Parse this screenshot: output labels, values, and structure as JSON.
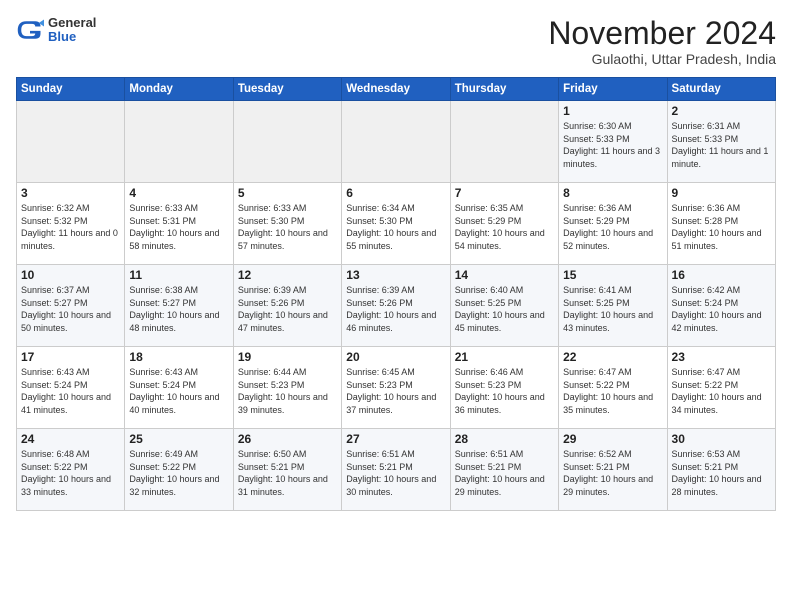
{
  "header": {
    "logo_general": "General",
    "logo_blue": "Blue",
    "month_title": "November 2024",
    "subtitle": "Gulaothi, Uttar Pradesh, India"
  },
  "days_of_week": [
    "Sunday",
    "Monday",
    "Tuesday",
    "Wednesday",
    "Thursday",
    "Friday",
    "Saturday"
  ],
  "weeks": [
    [
      {
        "day": "",
        "info": ""
      },
      {
        "day": "",
        "info": ""
      },
      {
        "day": "",
        "info": ""
      },
      {
        "day": "",
        "info": ""
      },
      {
        "day": "",
        "info": ""
      },
      {
        "day": "1",
        "info": "Sunrise: 6:30 AM\nSunset: 5:33 PM\nDaylight: 11 hours and 3 minutes."
      },
      {
        "day": "2",
        "info": "Sunrise: 6:31 AM\nSunset: 5:33 PM\nDaylight: 11 hours and 1 minute."
      }
    ],
    [
      {
        "day": "3",
        "info": "Sunrise: 6:32 AM\nSunset: 5:32 PM\nDaylight: 11 hours and 0 minutes."
      },
      {
        "day": "4",
        "info": "Sunrise: 6:33 AM\nSunset: 5:31 PM\nDaylight: 10 hours and 58 minutes."
      },
      {
        "day": "5",
        "info": "Sunrise: 6:33 AM\nSunset: 5:30 PM\nDaylight: 10 hours and 57 minutes."
      },
      {
        "day": "6",
        "info": "Sunrise: 6:34 AM\nSunset: 5:30 PM\nDaylight: 10 hours and 55 minutes."
      },
      {
        "day": "7",
        "info": "Sunrise: 6:35 AM\nSunset: 5:29 PM\nDaylight: 10 hours and 54 minutes."
      },
      {
        "day": "8",
        "info": "Sunrise: 6:36 AM\nSunset: 5:29 PM\nDaylight: 10 hours and 52 minutes."
      },
      {
        "day": "9",
        "info": "Sunrise: 6:36 AM\nSunset: 5:28 PM\nDaylight: 10 hours and 51 minutes."
      }
    ],
    [
      {
        "day": "10",
        "info": "Sunrise: 6:37 AM\nSunset: 5:27 PM\nDaylight: 10 hours and 50 minutes."
      },
      {
        "day": "11",
        "info": "Sunrise: 6:38 AM\nSunset: 5:27 PM\nDaylight: 10 hours and 48 minutes."
      },
      {
        "day": "12",
        "info": "Sunrise: 6:39 AM\nSunset: 5:26 PM\nDaylight: 10 hours and 47 minutes."
      },
      {
        "day": "13",
        "info": "Sunrise: 6:39 AM\nSunset: 5:26 PM\nDaylight: 10 hours and 46 minutes."
      },
      {
        "day": "14",
        "info": "Sunrise: 6:40 AM\nSunset: 5:25 PM\nDaylight: 10 hours and 45 minutes."
      },
      {
        "day": "15",
        "info": "Sunrise: 6:41 AM\nSunset: 5:25 PM\nDaylight: 10 hours and 43 minutes."
      },
      {
        "day": "16",
        "info": "Sunrise: 6:42 AM\nSunset: 5:24 PM\nDaylight: 10 hours and 42 minutes."
      }
    ],
    [
      {
        "day": "17",
        "info": "Sunrise: 6:43 AM\nSunset: 5:24 PM\nDaylight: 10 hours and 41 minutes."
      },
      {
        "day": "18",
        "info": "Sunrise: 6:43 AM\nSunset: 5:24 PM\nDaylight: 10 hours and 40 minutes."
      },
      {
        "day": "19",
        "info": "Sunrise: 6:44 AM\nSunset: 5:23 PM\nDaylight: 10 hours and 39 minutes."
      },
      {
        "day": "20",
        "info": "Sunrise: 6:45 AM\nSunset: 5:23 PM\nDaylight: 10 hours and 37 minutes."
      },
      {
        "day": "21",
        "info": "Sunrise: 6:46 AM\nSunset: 5:23 PM\nDaylight: 10 hours and 36 minutes."
      },
      {
        "day": "22",
        "info": "Sunrise: 6:47 AM\nSunset: 5:22 PM\nDaylight: 10 hours and 35 minutes."
      },
      {
        "day": "23",
        "info": "Sunrise: 6:47 AM\nSunset: 5:22 PM\nDaylight: 10 hours and 34 minutes."
      }
    ],
    [
      {
        "day": "24",
        "info": "Sunrise: 6:48 AM\nSunset: 5:22 PM\nDaylight: 10 hours and 33 minutes."
      },
      {
        "day": "25",
        "info": "Sunrise: 6:49 AM\nSunset: 5:22 PM\nDaylight: 10 hours and 32 minutes."
      },
      {
        "day": "26",
        "info": "Sunrise: 6:50 AM\nSunset: 5:21 PM\nDaylight: 10 hours and 31 minutes."
      },
      {
        "day": "27",
        "info": "Sunrise: 6:51 AM\nSunset: 5:21 PM\nDaylight: 10 hours and 30 minutes."
      },
      {
        "day": "28",
        "info": "Sunrise: 6:51 AM\nSunset: 5:21 PM\nDaylight: 10 hours and 29 minutes."
      },
      {
        "day": "29",
        "info": "Sunrise: 6:52 AM\nSunset: 5:21 PM\nDaylight: 10 hours and 29 minutes."
      },
      {
        "day": "30",
        "info": "Sunrise: 6:53 AM\nSunset: 5:21 PM\nDaylight: 10 hours and 28 minutes."
      }
    ]
  ]
}
